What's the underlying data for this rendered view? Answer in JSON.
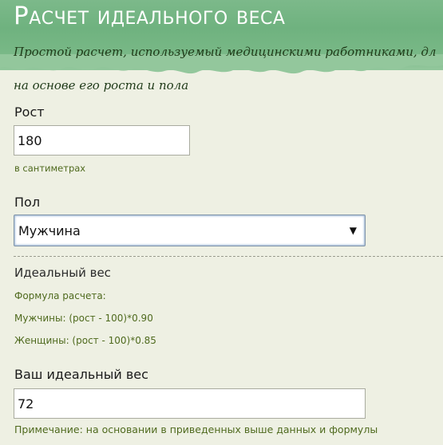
{
  "header": {
    "title": "Расчет идеального веса",
    "subtitle_line1": "Простой расчет, используемый медицинскими работниками, дл",
    "subtitle_line2": "на основе его роста и пола"
  },
  "form": {
    "height": {
      "label": "Рост",
      "value": "180",
      "hint": "в сантиметрах"
    },
    "gender": {
      "label": "Пол",
      "selected": "Мужчина",
      "arrow": "▼"
    }
  },
  "ideal_weight": {
    "title": "Идеальный вес",
    "formula_label": "Формула расчета:",
    "formula_men": "Мужчины: (рост - 100)*0.90",
    "formula_women": "Женщины: (рост - 100)*0.85"
  },
  "result": {
    "label": "Ваш идеальный вес",
    "value": "72",
    "note": "Примечание: на основании в приведенных выше данных и формулы"
  },
  "colors": {
    "banner": "#6fb27f",
    "background": "#eef0e3",
    "hint_text": "#4f6a1e"
  }
}
